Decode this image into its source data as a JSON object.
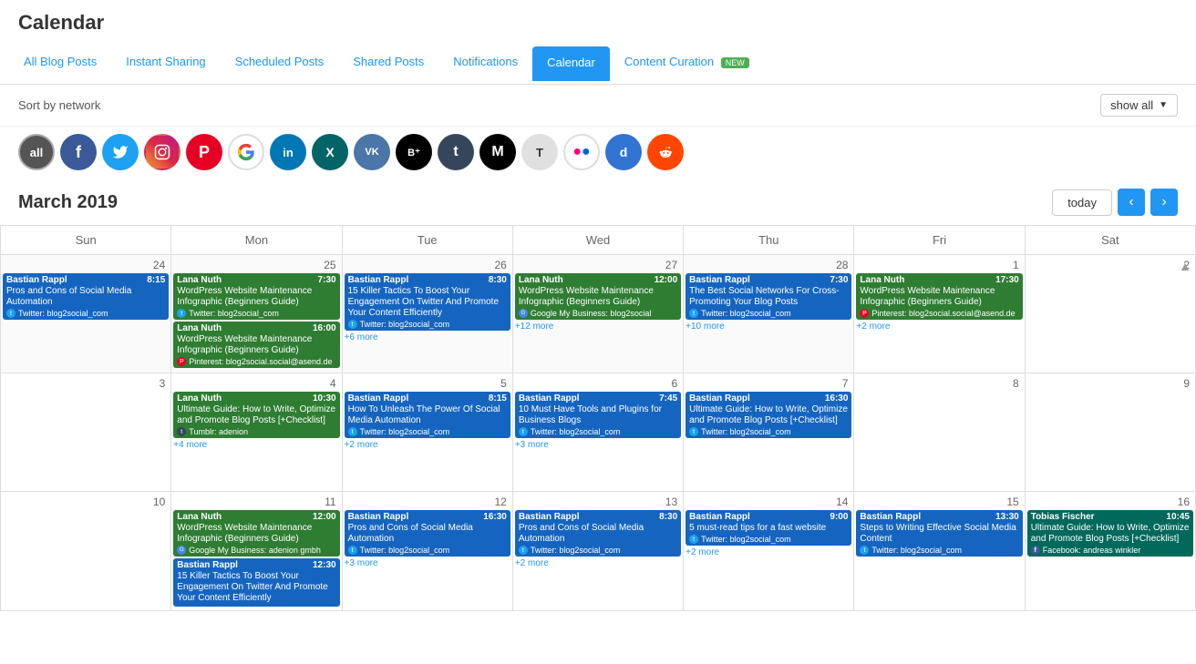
{
  "page": {
    "title": "Calendar"
  },
  "nav": {
    "tabs": [
      {
        "id": "all-blog-posts",
        "label": "All Blog Posts",
        "active": false
      },
      {
        "id": "instant-sharing",
        "label": "Instant Sharing",
        "active": false
      },
      {
        "id": "scheduled-posts",
        "label": "Scheduled Posts",
        "active": false
      },
      {
        "id": "shared-posts",
        "label": "Shared Posts",
        "active": false
      },
      {
        "id": "notifications",
        "label": "Notifications",
        "active": false
      },
      {
        "id": "calendar",
        "label": "Calendar",
        "active": true
      },
      {
        "id": "content-curation",
        "label": "Content Curation",
        "badge": "NEW",
        "active": false
      }
    ]
  },
  "sort": {
    "label": "Sort by network",
    "show_all": "show all"
  },
  "networks": [
    {
      "id": "all",
      "label": "all",
      "class": "all"
    },
    {
      "id": "facebook",
      "label": "f",
      "class": "facebook"
    },
    {
      "id": "twitter",
      "label": "🐦",
      "class": "twitter"
    },
    {
      "id": "instagram",
      "label": "📷",
      "class": "instagram"
    },
    {
      "id": "pinterest",
      "label": "P",
      "class": "pinterest"
    },
    {
      "id": "google",
      "label": "G",
      "class": "google"
    },
    {
      "id": "linkedin",
      "label": "in",
      "class": "linkedin"
    },
    {
      "id": "xing",
      "label": "X",
      "class": "xing"
    },
    {
      "id": "vk",
      "label": "VK",
      "class": "vk"
    },
    {
      "id": "bloglovin",
      "label": "B⁺",
      "class": "bloglovin"
    },
    {
      "id": "tumblr",
      "label": "t",
      "class": "tumblr"
    },
    {
      "id": "medium",
      "label": "M",
      "class": "medium"
    },
    {
      "id": "typepad",
      "label": "T",
      "class": "typepad"
    },
    {
      "id": "flickr",
      "label": "●",
      "class": "flickr"
    },
    {
      "id": "delicious",
      "label": "d",
      "class": "delicious"
    },
    {
      "id": "reddit",
      "label": "👾",
      "class": "reddit"
    }
  ],
  "calendar": {
    "month": "March 2019",
    "today_label": "today",
    "days": [
      "Sun",
      "Mon",
      "Tue",
      "Wed",
      "Thu",
      "Fri",
      "Sat"
    ]
  }
}
